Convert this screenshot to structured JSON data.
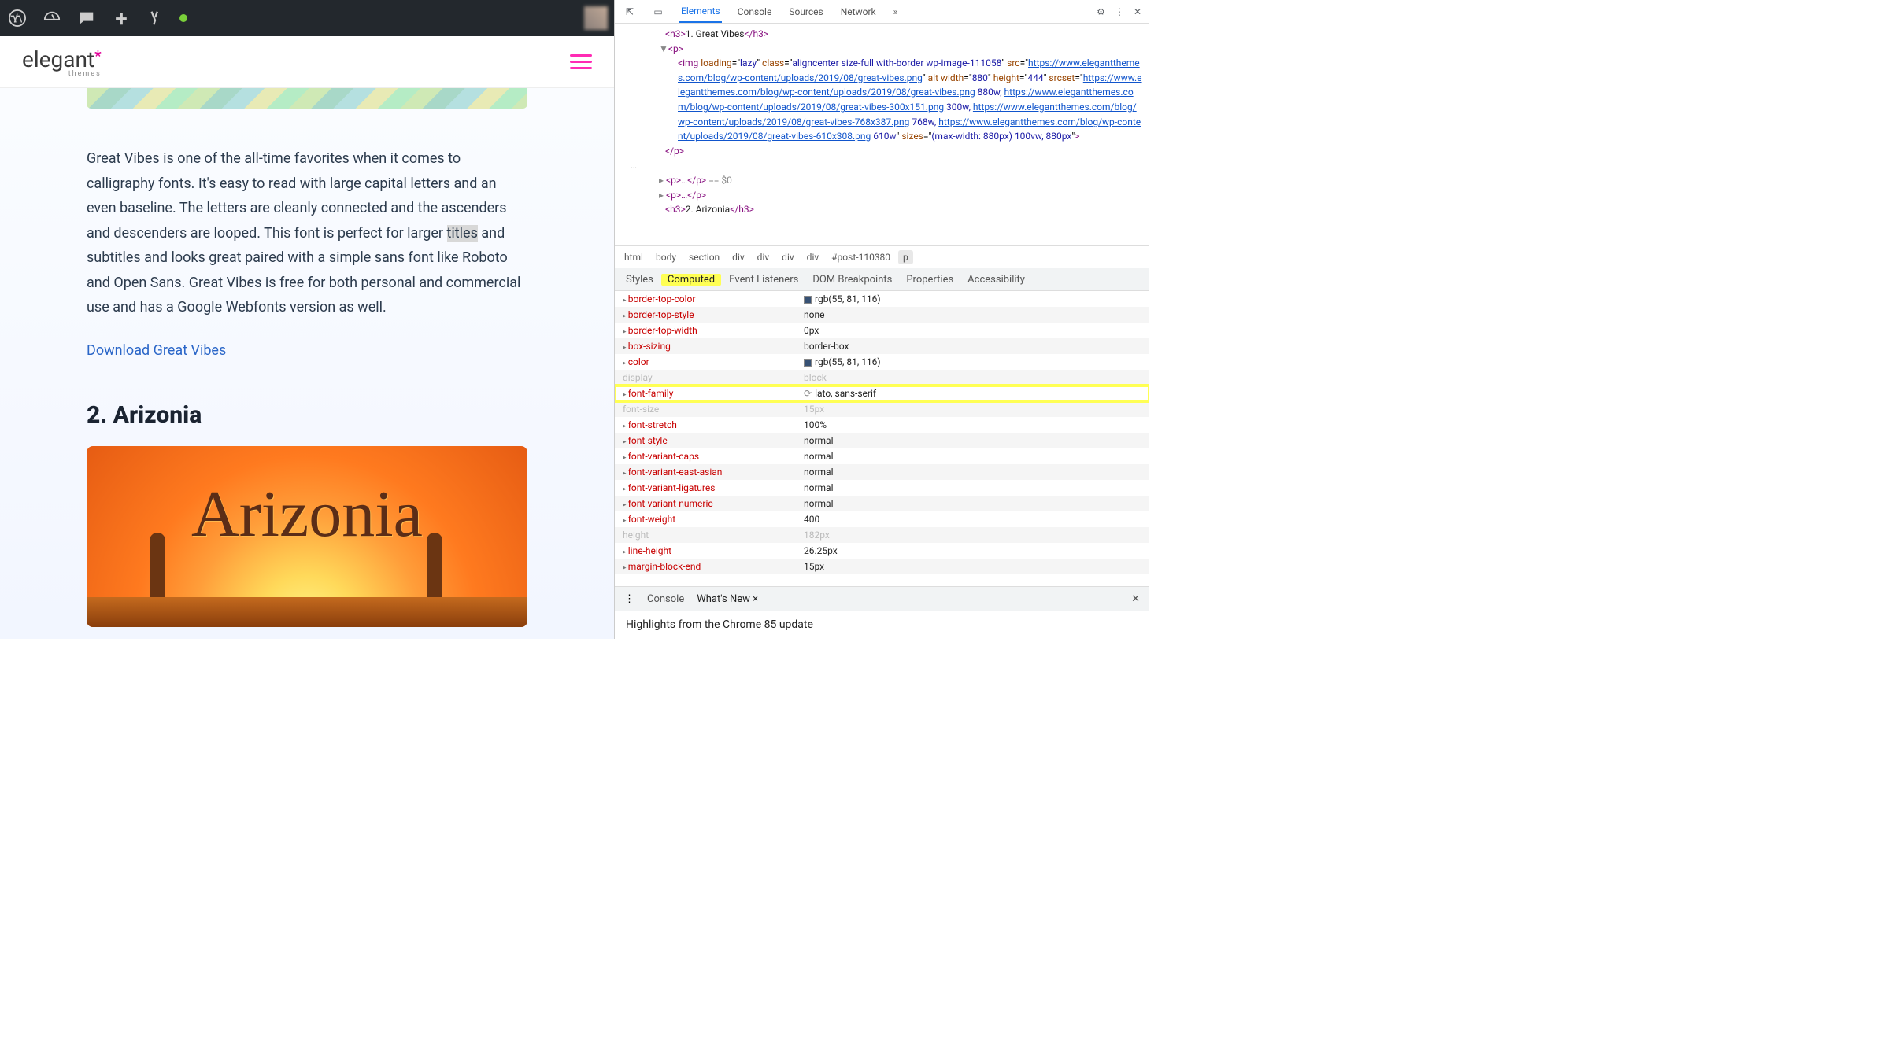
{
  "logo": {
    "main": "elegant",
    "sub": "themes"
  },
  "paragraph": "Great Vibes is one of the all-time favorites when it comes to calligraphy fonts.  It's easy to read with large capital letters and an even baseline. The letters are cleanly connected and the ascenders and descenders are looped. This font is perfect for larger titles and subtitles and looks great paired with a simple sans font like Roboto and Open Sans. Great Vibes is free for both personal and commercial use and has a Google Webfonts version as well.",
  "download_link": "Download Great Vibes",
  "heading2": "2. Arizonia",
  "arizonia_text": "Arizonia",
  "devtools": {
    "tabs": [
      "Elements",
      "Console",
      "Sources",
      "Network"
    ],
    "more": "»",
    "dom": {
      "h3_prev": {
        "open": "<h3>",
        "txt": "1. Great Vibes",
        "close": "</h3>"
      },
      "p_open": "<p>",
      "img_parts": {
        "pre": "<img loading=\"",
        "lazy": "lazy",
        "class_label": "\" class=\"",
        "class_val": "aligncenter size-full with-border wp-image-111058",
        "src_label": "\" src=\"",
        "src_url": "https://www.elegantthemes.com/blog/wp-content/uploads/2019/08/great-vibes.png",
        "alt": "\" alt width=\"",
        "w": "880",
        "h_label": "\" height=\"",
        "h": "444",
        "srcset_label": "\" srcset=\"",
        "url1": "https://www.elegantthemes.com/blog/wp-content/uploads/2019/08/great-vibes.png",
        "sz1": " 880w, ",
        "url2": "https://www.elegantthemes.com/blog/wp-content/uploads/2019/08/great-vibes-300x151.png",
        "sz2": " 300w, ",
        "url3": "https://www.elegantthemes.com/blog/wp-content/uploads/2019/08/great-vibes-768x387.png",
        "sz3": " 768w, ",
        "url4": "https://www.elegantthemes.com/blog/wp-content/uploads/2019/08/great-vibes-610x308.png",
        "sz4": " 610w",
        "sizes_label": "\" sizes=\"",
        "sizes_val": "(max-width: 880px) 100vw, 880px",
        "close": "\">"
      },
      "p_close": "</p>",
      "p_sel": {
        "lead": "<p>…</p>",
        "tail": " == $0"
      },
      "p_folded": "<p>…</p>",
      "h3_next": {
        "open": "<h3>",
        "txt": "2. Arizonia",
        "close": "</h3>"
      }
    },
    "crumbs": [
      "html",
      "body",
      "section",
      "div",
      "div",
      "div",
      "div",
      "#post-110380",
      "p"
    ],
    "pane_tabs": [
      "Styles",
      "Computed",
      "Event Listeners",
      "DOM Breakpoints",
      "Properties",
      "Accessibility"
    ],
    "computed": [
      {
        "k": "border-top-color",
        "v": "rgb(55, 81, 116)",
        "swatch": "#375174"
      },
      {
        "k": "border-top-style",
        "v": "none"
      },
      {
        "k": "border-top-width",
        "v": "0px"
      },
      {
        "k": "box-sizing",
        "v": "border-box"
      },
      {
        "k": "color",
        "v": "rgb(55, 81, 116)",
        "swatch": "#375174"
      },
      {
        "k": "display",
        "v": "block",
        "gray": true
      },
      {
        "k": "font-family",
        "v": "lato, sans-serif",
        "hl": true,
        "nav": true
      },
      {
        "k": "font-size",
        "v": "15px",
        "gray": true
      },
      {
        "k": "font-stretch",
        "v": "100%"
      },
      {
        "k": "font-style",
        "v": "normal"
      },
      {
        "k": "font-variant-caps",
        "v": "normal"
      },
      {
        "k": "font-variant-east-asian",
        "v": "normal"
      },
      {
        "k": "font-variant-ligatures",
        "v": "normal"
      },
      {
        "k": "font-variant-numeric",
        "v": "normal"
      },
      {
        "k": "font-weight",
        "v": "400"
      },
      {
        "k": "height",
        "v": "182px",
        "gray": true
      },
      {
        "k": "line-height",
        "v": "26.25px"
      },
      {
        "k": "margin-block-end",
        "v": "15px"
      }
    ],
    "drawer_tabs": [
      "Console",
      "What's New"
    ],
    "highlights": "Highlights from the Chrome 85 update"
  }
}
